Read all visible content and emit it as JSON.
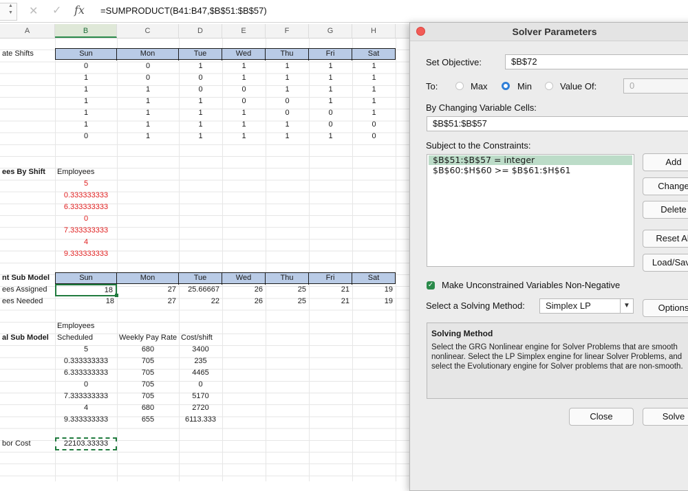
{
  "formula_bar": {
    "fx_label": "fx",
    "formula": "=SUMPRODUCT(B41:B47,$B$51:$B$57)"
  },
  "columns": [
    "A",
    "B",
    "C",
    "D",
    "E",
    "F",
    "G",
    "H"
  ],
  "sheet": {
    "shifts_label": "ate Shifts",
    "days": [
      "Sun",
      "Mon",
      "Tue",
      "Wed",
      "Thu",
      "Fri",
      "Sat"
    ],
    "shift_matrix": [
      [
        "0",
        "0",
        "1",
        "1",
        "1",
        "1",
        "1"
      ],
      [
        "1",
        "0",
        "0",
        "1",
        "1",
        "1",
        "1"
      ],
      [
        "1",
        "1",
        "0",
        "0",
        "1",
        "1",
        "1"
      ],
      [
        "1",
        "1",
        "1",
        "0",
        "0",
        "1",
        "1"
      ],
      [
        "1",
        "1",
        "1",
        "1",
        "0",
        "0",
        "1"
      ],
      [
        "1",
        "1",
        "1",
        "1",
        "1",
        "0",
        "0"
      ],
      [
        "0",
        "1",
        "1",
        "1",
        "1",
        "1",
        "0"
      ]
    ],
    "by_shift_label": "ees By Shift",
    "employees_label": "Employees",
    "employees": [
      "5",
      "0.333333333",
      "6.333333333",
      "0",
      "7.333333333",
      "4",
      "9.333333333"
    ],
    "sub_model_label": "nt Sub Model",
    "assigned_label": "ees Assigned",
    "needed_label": "ees Needed",
    "assigned": [
      "18",
      "27",
      "25.66667",
      "26",
      "25",
      "21",
      "19"
    ],
    "needed": [
      "18",
      "27",
      "22",
      "26",
      "25",
      "21",
      "19"
    ],
    "cost_model_label": "al Sub Model",
    "emp_hdr1": "Employees",
    "emp_hdr2": "Scheduled",
    "pay_hdr": "Weekly Pay Rate",
    "cost_hdr": "Cost/shift",
    "cost_rows": [
      [
        "5",
        "680",
        "3400"
      ],
      [
        "0.333333333",
        "705",
        "235"
      ],
      [
        "6.333333333",
        "705",
        "4465"
      ],
      [
        "0",
        "705",
        "0"
      ],
      [
        "7.333333333",
        "705",
        "5170"
      ],
      [
        "4",
        "680",
        "2720"
      ],
      [
        "9.333333333",
        "655",
        "6113.333"
      ]
    ],
    "labor_label": "bor Cost",
    "labor_value": "22103.33333"
  },
  "dialog": {
    "title": "Solver Parameters",
    "set_objective_label": "Set Objective:",
    "objective_value": "$B$72",
    "to_label": "To:",
    "max_label": "Max",
    "min_label": "Min",
    "valueof_label": "Value Of:",
    "valueof_value": "0",
    "changing_label": "By Changing Variable Cells:",
    "changing_value": "$B$51:$B$57",
    "constraints_label": "Subject to the Constraints:",
    "constraints": [
      "$B$51:$B$57 = integer",
      "$B$60:$H$60 >= $B$61:$H$61"
    ],
    "add_label": "Add",
    "change_label": "Change",
    "delete_label": "Delete",
    "reset_label": "Reset All",
    "load_label": "Load/Save",
    "nonneg_label": "Make Unconstrained Variables Non-Negative",
    "method_label": "Select a Solving Method:",
    "method_value": "Simplex LP",
    "options_label": "Options",
    "method_title": "Solving Method",
    "method_text": "Select the GRG Nonlinear engine for Solver Problems that are smooth nonlinear. Select the LP Simplex engine for linear Solver Problems, and select the Evolutionary engine for Solver problems that are non-smooth.",
    "close_label": "Close",
    "solve_label": "Solve"
  },
  "colors": {
    "header_fill": "#b9cbe6",
    "accent_green": "#1f7a3d",
    "red_text": "#e01e1e",
    "close_red": "#f25b56"
  }
}
